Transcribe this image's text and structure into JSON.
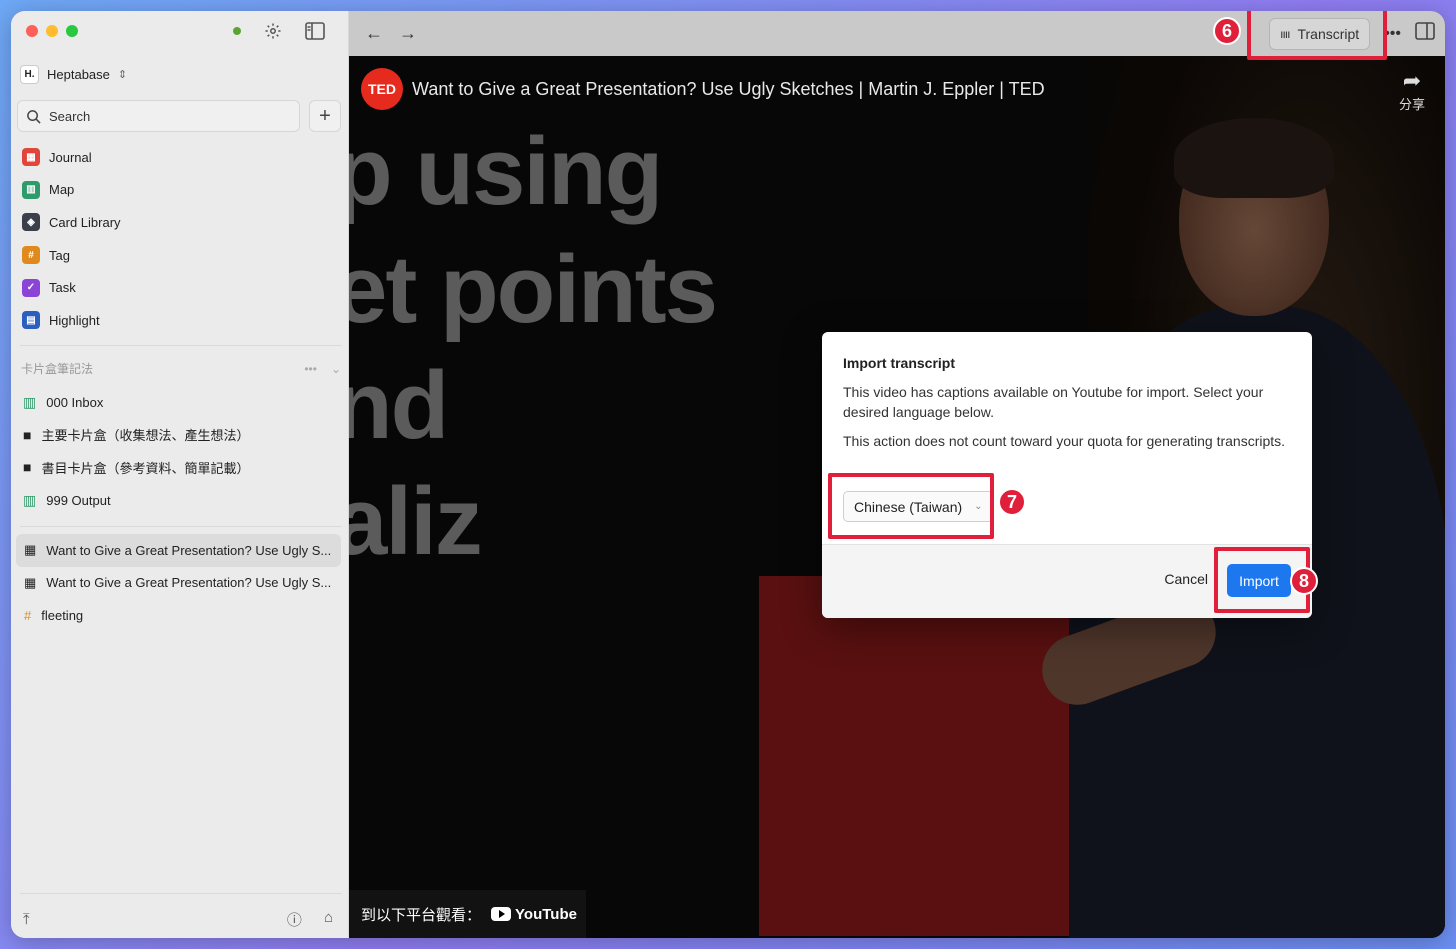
{
  "sidebar": {
    "workspace_logo": "H.",
    "workspace_name": "Heptabase",
    "search_label": "Search",
    "nav_items": [
      {
        "label": "Journal",
        "icon": "journal-icon",
        "color": "#e0463b"
      },
      {
        "label": "Map",
        "icon": "map-icon",
        "color": "#2f9a6a"
      },
      {
        "label": "Card Library",
        "icon": "card-library-icon",
        "color": "#3a3f4a"
      },
      {
        "label": "Tag",
        "icon": "tag-icon",
        "color": "#e08a1e"
      },
      {
        "label": "Task",
        "icon": "task-icon",
        "color": "#8a45d6"
      },
      {
        "label": "Highlight",
        "icon": "highlight-icon",
        "color": "#2b5fbf"
      }
    ],
    "section_title": "卡片盒筆記法",
    "tree_items": [
      {
        "label": "000 Inbox",
        "icon": "map-icon"
      },
      {
        "label": "主要卡片盒（收集想法、產生想法）",
        "icon": "folder-icon"
      },
      {
        "label": "書目卡片盒（參考資料、簡單記載）",
        "icon": "folder-icon"
      },
      {
        "label": "999 Output",
        "icon": "map-icon"
      }
    ],
    "doc_items": [
      {
        "label": "Want to Give a Great Presentation? Use Ugly S...",
        "icon": "video-icon"
      },
      {
        "label": "Want to Give a Great Presentation? Use Ugly S...",
        "icon": "video-icon"
      },
      {
        "label": "fleeting",
        "icon": "hashtag-icon"
      }
    ]
  },
  "toolbar": {
    "transcript_label": "Transcript",
    "step6": "6"
  },
  "video": {
    "ted_logo": "TED",
    "title": "Want to Give a Great Presentation? Use Ugly Sketches | Martin J. Eppler | TED",
    "share_label": "分享",
    "big_lines": [
      "p using",
      "et points",
      "nd",
      "aliz"
    ],
    "watch_on": "到以下平台觀看：",
    "youtube_label": "YouTube"
  },
  "modal": {
    "title": "Import transcript",
    "paragraph1": "This video has captions available on Youtube for import. Select your desired language below.",
    "paragraph2": "This action does not count toward your quota for generating transcripts.",
    "language_selected": "Chinese (Taiwan)",
    "cancel_label": "Cancel",
    "import_label": "Import",
    "step7": "7",
    "step8": "8"
  },
  "colors": {
    "annotation_red": "#e0203b",
    "import_blue": "#1d78f0"
  }
}
